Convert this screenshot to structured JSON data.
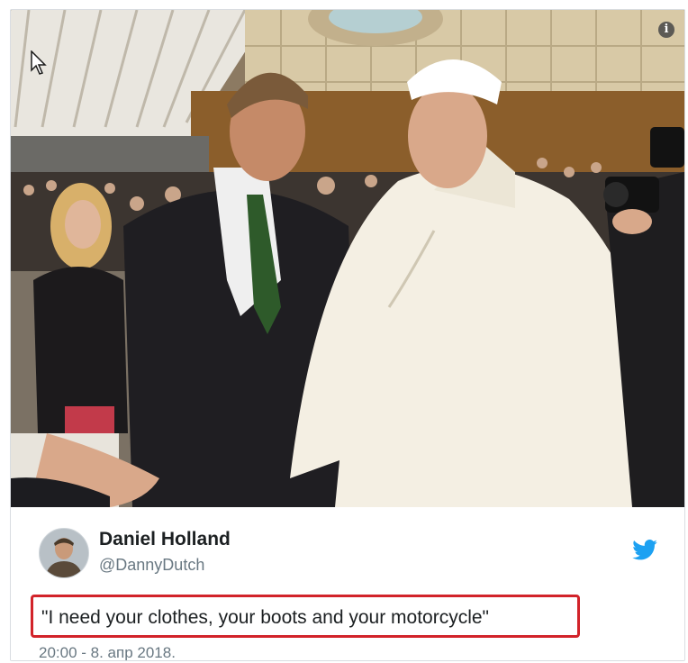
{
  "tweet": {
    "author": {
      "display_name": "Daniel Holland",
      "handle": "@DannyDutch"
    },
    "text": "\"I need your clothes, your boots and your motorcycle\"",
    "timestamp": "20:00 - 8. апр 2018.",
    "highlight_color": "#d2232a"
  },
  "media": {
    "info_icon": "info-icon",
    "cursor": "cursor-arrow-icon"
  },
  "brand": {
    "icon": "twitter-bird-icon",
    "color": "#1da1f2"
  }
}
